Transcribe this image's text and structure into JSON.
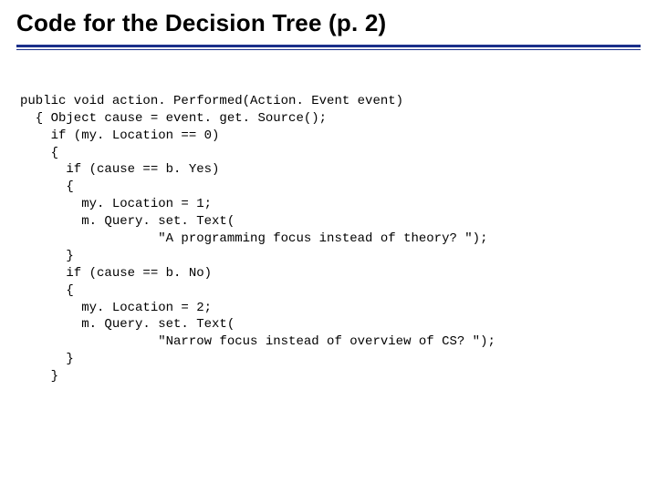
{
  "title": "Code for the Decision Tree   (p. 2)",
  "code": {
    "l01": "public void action. Performed(Action. Event event)",
    "l02": "  { Object cause = event. get. Source();",
    "l03": "    if (my. Location == 0)",
    "l04": "    {",
    "l05": "      if (cause == b. Yes)",
    "l06": "      {",
    "l07": "        my. Location = 1;",
    "l08": "        m. Query. set. Text(",
    "l09": "                  \"A programming focus instead of theory? \");",
    "l10": "      }",
    "l11": "      if (cause == b. No)",
    "l12": "      {",
    "l13": "        my. Location = 2;",
    "l14": "        m. Query. set. Text(",
    "l15": "                  \"Narrow focus instead of overview of CS? \");",
    "l16": "      }",
    "l17": "    }"
  }
}
